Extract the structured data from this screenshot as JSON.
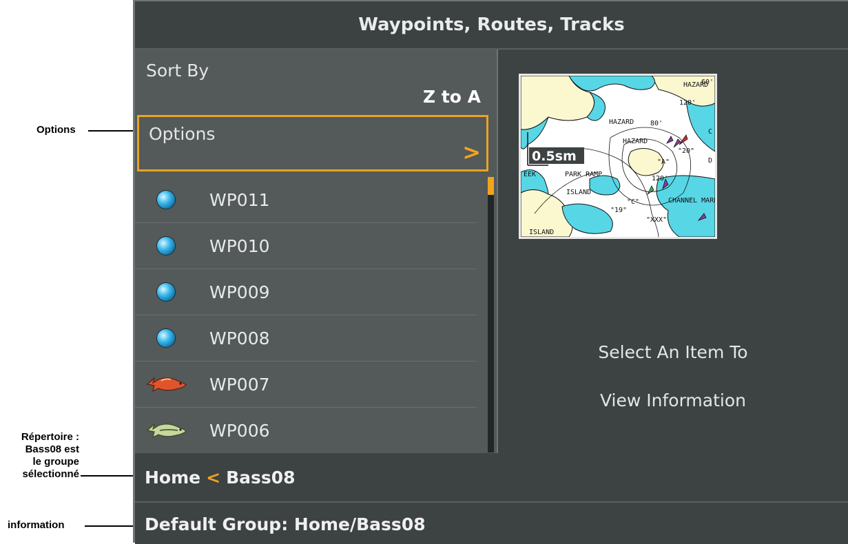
{
  "callouts": {
    "options": "Options",
    "repertoire": [
      "Répertoire :",
      "Bass08 est",
      "le groupe",
      "sélectionné"
    ],
    "information": "information"
  },
  "title": "Waypoints, Routes, Tracks",
  "sort": {
    "label": "Sort By",
    "value": "Z to A"
  },
  "options": {
    "label": "Options",
    "arrow": ">"
  },
  "waypoints": [
    {
      "name": "WP011",
      "icon": "blue-dot-icon"
    },
    {
      "name": "WP010",
      "icon": "blue-dot-icon"
    },
    {
      "name": "WP009",
      "icon": "blue-dot-icon"
    },
    {
      "name": "WP008",
      "icon": "blue-dot-icon"
    },
    {
      "name": "WP007",
      "icon": "red-fish-icon"
    },
    {
      "name": "WP006",
      "icon": "bass-fish-icon"
    }
  ],
  "map": {
    "scale": "0.5sm",
    "labels": [
      "HAZARD",
      "HAZARD",
      "HAZARD",
      "80'",
      "60'",
      "120'",
      "120'",
      "PARK RAMP",
      "ISLAND",
      "ISLAND",
      "CHANNEL MARK",
      "\"A\"",
      "\"20\"",
      "\"C\"",
      "\"19\"",
      "\"XXX\"",
      "EEK",
      "C",
      "D"
    ]
  },
  "info": {
    "line1": "Select An Item To",
    "line2": "View Information"
  },
  "breadcrumb": {
    "home": "Home",
    "separator": "<",
    "group": "Bass08"
  },
  "status": {
    "text": "Default Group: Home/Bass08"
  },
  "colors": {
    "accent": "#f0a51d",
    "screen_bg": "#3d4242",
    "list_bg": "#545959",
    "water": "#57d6e6",
    "land": "#fbf7cf"
  }
}
